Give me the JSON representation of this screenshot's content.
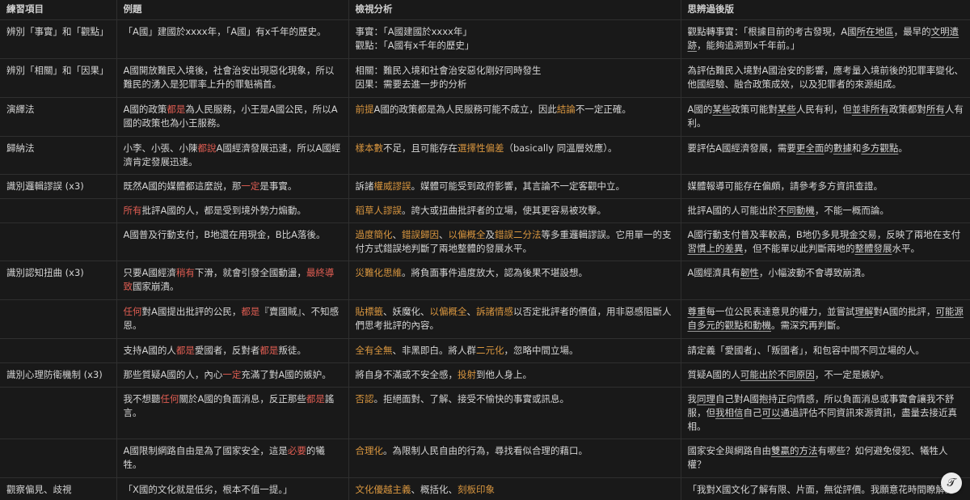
{
  "headers": [
    "練習項目",
    "例題",
    "檢視分析",
    "思辨過後版"
  ],
  "rows": [
    {
      "item": [
        {
          "t": "辨別「事實」和「觀點」"
        }
      ],
      "example": [
        {
          "t": "「A國」建國於xxxx年，「A國」有x千年的歷史。"
        }
      ],
      "analysis": [
        {
          "t": "事實：「A國建國於xxxx年」\n觀點：「A國有x千年的歷史」"
        }
      ],
      "revised": [
        {
          "t": "觀點轉事實：「根據目前的考古發現，A國"
        },
        {
          "t": "所在地區",
          "s": "ul"
        },
        {
          "t": "，最早的"
        },
        {
          "t": "文明遺跡",
          "s": "ul"
        },
        {
          "t": "，能夠追溯到x千年前。」"
        }
      ]
    },
    {
      "item": [
        {
          "t": "辨別「相關」和「因果」"
        }
      ],
      "example": [
        {
          "t": "A國開放難民入境後，社會治安出現惡化現象，所以難民的湧入是犯罪率上升的罪魁禍首。"
        }
      ],
      "analysis": [
        {
          "t": "相關：難民入境和社會治安惡化剛好同時發生\n因果：需要去進一步的分析"
        }
      ],
      "revised": [
        {
          "t": "為評估難民入境對A國治安的影響，應考量入境前後的犯罪率變化、他國經驗、融合政策成效，以及犯罪者的來源組成。"
        }
      ]
    },
    {
      "item": [
        {
          "t": "演繹法"
        }
      ],
      "example": [
        {
          "t": "A國的政策"
        },
        {
          "t": "都是",
          "s": "red"
        },
        {
          "t": "為人民服務，小王是A國公民，所以A國的政策也為小王服務。"
        }
      ],
      "analysis": [
        {
          "t": "前提",
          "s": "orange"
        },
        {
          "t": "A國的政策都是為人民服務可能不成立，因此"
        },
        {
          "t": "結論",
          "s": "orange"
        },
        {
          "t": "不一定正確。"
        }
      ],
      "revised": [
        {
          "t": "A國的"
        },
        {
          "t": "某些",
          "s": "ul"
        },
        {
          "t": "政策可能對"
        },
        {
          "t": "某些",
          "s": "ul"
        },
        {
          "t": "人民有利，但"
        },
        {
          "t": "並非所有",
          "s": "ul"
        },
        {
          "t": "政策都對"
        },
        {
          "t": "所有",
          "s": "ul"
        },
        {
          "t": "人有利。"
        }
      ]
    },
    {
      "item": [
        {
          "t": "歸納法"
        }
      ],
      "example": [
        {
          "t": "小李、小張、小陳"
        },
        {
          "t": "都說",
          "s": "red"
        },
        {
          "t": "A國經濟發展迅速，所以A國經濟肯定發展迅速。"
        }
      ],
      "analysis": [
        {
          "t": "樣本數",
          "s": "orange"
        },
        {
          "t": "不足，且可能存在"
        },
        {
          "t": "選擇性偏差",
          "s": "orange"
        },
        {
          "t": "（basically 同溫層效應）。"
        }
      ],
      "revised": [
        {
          "t": "要評估A國經濟發展，需要"
        },
        {
          "t": "更全面",
          "s": "ul"
        },
        {
          "t": "的"
        },
        {
          "t": "數據",
          "s": "ul"
        },
        {
          "t": "和"
        },
        {
          "t": "多方觀點",
          "s": "ul"
        },
        {
          "t": "。"
        }
      ]
    },
    {
      "item": [
        {
          "t": "識別邏輯謬誤 (x3)"
        }
      ],
      "example": [
        {
          "t": "既然A國的媒體都這麼說，那"
        },
        {
          "t": "一定",
          "s": "red"
        },
        {
          "t": "是事實。"
        }
      ],
      "analysis": [
        {
          "t": "訴諸"
        },
        {
          "t": "權威謬誤",
          "s": "orange"
        },
        {
          "t": "。媒體可能受到政府影響，其言論不一定客觀中立。"
        }
      ],
      "revised": [
        {
          "t": "媒體報導可能存在偏頗，請參考多方資訊查證。"
        }
      ]
    },
    {
      "item": [
        {
          "t": ""
        }
      ],
      "example": [
        {
          "t": "所有",
          "s": "red"
        },
        {
          "t": "批評A國的人，都是受到境外勢力煽動。"
        }
      ],
      "analysis": [
        {
          "t": "稻草人謬誤",
          "s": "orange"
        },
        {
          "t": "。誇大或扭曲批評者的立場，使其更容易被攻擊。"
        }
      ],
      "revised": [
        {
          "t": "批評A國的人可能出於"
        },
        {
          "t": "不同動機",
          "s": "ul"
        },
        {
          "t": "，不能一概而論。"
        }
      ]
    },
    {
      "item": [
        {
          "t": ""
        }
      ],
      "example": [
        {
          "t": "A國普及行動支付，B地還在用現金，B比A落後。"
        }
      ],
      "analysis": [
        {
          "t": "過度簡化",
          "s": "orange"
        },
        {
          "t": "、"
        },
        {
          "t": "錯誤歸因",
          "s": "orange"
        },
        {
          "t": "、"
        },
        {
          "t": "以偏概全",
          "s": "orange"
        },
        {
          "t": "及"
        },
        {
          "t": "錯誤二分法",
          "s": "orange"
        },
        {
          "t": "等多重邏輯謬誤。它用單一的支付方式錯誤地判斷了兩地整體的發展水平。"
        }
      ],
      "revised": [
        {
          "t": "A國行動支付普及率較高，B地仍多見現金交易，反映了兩地在支付"
        },
        {
          "t": "習慣上的差異",
          "s": "ul"
        },
        {
          "t": "，但不能單以此判斷兩地的"
        },
        {
          "t": "整體發展",
          "s": "ul"
        },
        {
          "t": "水平。"
        }
      ]
    },
    {
      "item": [
        {
          "t": "識別認知扭曲 (x3)"
        }
      ],
      "example": [
        {
          "t": "只要A國經濟"
        },
        {
          "t": "稍有",
          "s": "red"
        },
        {
          "t": "下滑，就會引發全國動盪，"
        },
        {
          "t": "最終導致",
          "s": "red"
        },
        {
          "t": "國家崩潰。"
        }
      ],
      "analysis": [
        {
          "t": "災難化思維",
          "s": "orange"
        },
        {
          "t": "。將負面事件過度放大，認為後果不堪設想。"
        }
      ],
      "revised": [
        {
          "t": "A國經濟具有"
        },
        {
          "t": "韌性",
          "s": "ul"
        },
        {
          "t": "，小幅波動不會導致崩潰。"
        }
      ]
    },
    {
      "item": [
        {
          "t": ""
        }
      ],
      "example": [
        {
          "t": "任何",
          "s": "red"
        },
        {
          "t": "對A國提出批評的公民，"
        },
        {
          "t": "都是",
          "s": "red"
        },
        {
          "t": "『賣國賊』、不知感恩。"
        }
      ],
      "analysis": [
        {
          "t": "貼標籤",
          "s": "orange"
        },
        {
          "t": "、妖魔化、"
        },
        {
          "t": "以偏概全",
          "s": "orange"
        },
        {
          "t": "、"
        },
        {
          "t": "訴諸情感",
          "s": "orange"
        },
        {
          "t": "以否定批評者的價值，用非惡感阻斷人們思考批評的內容。"
        }
      ],
      "revised": [
        {
          "t": "尊重",
          "s": "ul"
        },
        {
          "t": "每一位公民表達意見的權力，並嘗試"
        },
        {
          "t": "理解",
          "s": "ul"
        },
        {
          "t": "對A國的批評，"
        },
        {
          "t": "可能源自多元的觀點和動機",
          "s": "ul"
        },
        {
          "t": "。需深究再判斷。"
        }
      ]
    },
    {
      "item": [
        {
          "t": ""
        }
      ],
      "example": [
        {
          "t": "支持A國的人"
        },
        {
          "t": "都是",
          "s": "red"
        },
        {
          "t": "愛國者，反對者"
        },
        {
          "t": "都是",
          "s": "red"
        },
        {
          "t": "叛徒。"
        }
      ],
      "analysis": [
        {
          "t": "全有全無",
          "s": "orange"
        },
        {
          "t": "、非黑即白。將人群"
        },
        {
          "t": "二元化",
          "s": "orange"
        },
        {
          "t": "，忽略中間立場。"
        }
      ],
      "revised": [
        {
          "t": "請定義「愛國者」、「叛國者」，和包容中間不同立場的人。"
        }
      ]
    },
    {
      "item": [
        {
          "t": "識別心理防衛機制 (x3)"
        }
      ],
      "example": [
        {
          "t": "那些質疑A國的人，內心"
        },
        {
          "t": "一定",
          "s": "red"
        },
        {
          "t": "充滿了對A國的嫉妒。"
        }
      ],
      "analysis": [
        {
          "t": "將自身不滿或不安全感，"
        },
        {
          "t": "投射",
          "s": "orange"
        },
        {
          "t": "到他人身上。"
        }
      ],
      "revised": [
        {
          "t": "質疑A國的人"
        },
        {
          "t": "可能出於不同原因",
          "s": "ul"
        },
        {
          "t": "，不一定是嫉妒。"
        }
      ]
    },
    {
      "item": [
        {
          "t": ""
        }
      ],
      "example": [
        {
          "t": "我不想聽"
        },
        {
          "t": "任何",
          "s": "red"
        },
        {
          "t": "關於A國的負面消息，反正那些"
        },
        {
          "t": "都是",
          "s": "red"
        },
        {
          "t": "謠言。"
        }
      ],
      "analysis": [
        {
          "t": "否認",
          "s": "orange"
        },
        {
          "t": "。拒絕面對、了解、接受不愉快的事實或訊息。"
        }
      ],
      "revised": [
        {
          "t": "我"
        },
        {
          "t": "同理",
          "s": "ul"
        },
        {
          "t": "自己對A國抱持正向情感，所以負面消息或事實會讓我不舒服，但"
        },
        {
          "t": "我相信",
          "s": "ul"
        },
        {
          "t": "自己"
        },
        {
          "t": "可以",
          "s": "ul"
        },
        {
          "t": "通過評估不同資訊來源資訊，盡量去接近真相。"
        }
      ]
    },
    {
      "item": [
        {
          "t": ""
        }
      ],
      "example": [
        {
          "t": "A國限制網路自由是為了國家安全，這是"
        },
        {
          "t": "必要",
          "s": "red"
        },
        {
          "t": "的犧牲。"
        }
      ],
      "analysis": [
        {
          "t": "合理化",
          "s": "orange"
        },
        {
          "t": "。為限制人民自由的行為，尋找看似合理的藉口。"
        }
      ],
      "revised": [
        {
          "t": "國家安全與網路自由"
        },
        {
          "t": "雙贏的方法",
          "s": "ul"
        },
        {
          "t": "有哪些？如何避免侵犯、犧牲人權？"
        }
      ]
    },
    {
      "item": [
        {
          "t": "觀察偏見、歧視"
        }
      ],
      "example": [
        {
          "t": "「X國的文化就是低劣，根本不值一提。」"
        }
      ],
      "analysis": [
        {
          "t": "文化優越主義",
          "s": "orange"
        },
        {
          "t": "、概括化、"
        },
        {
          "t": "刻板印象",
          "s": "orange"
        }
      ],
      "revised": [
        {
          "t": "「我對X國文化了解有限、片面，無從評價。我願意花時間瞭解。」"
        }
      ]
    }
  ],
  "fab_glyph": "𝒯",
  "colors": {
    "red": "#e05d52",
    "orange": "#d9963f",
    "background": "#191919",
    "text": "#d4d4d4"
  }
}
